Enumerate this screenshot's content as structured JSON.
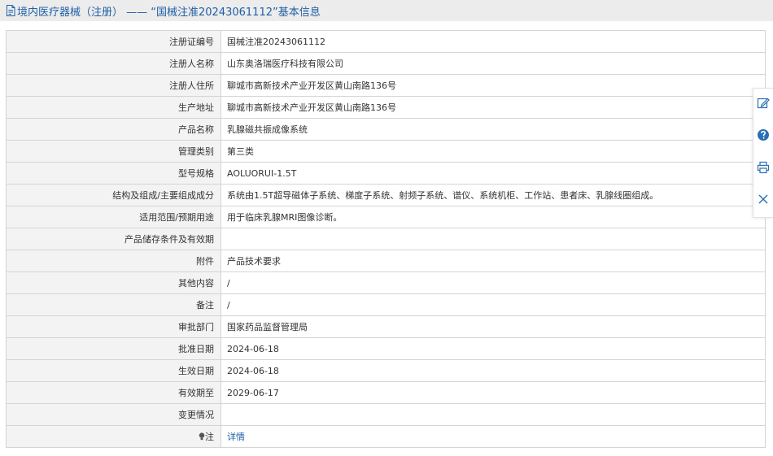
{
  "header": {
    "title": "境内医疗器械（注册） —— “国械注准20243061112”基本信息"
  },
  "colors": {
    "accent": "#1f5fa6",
    "label_bg": "#f3f3f3",
    "header_bg": "#ececec"
  },
  "rows": [
    {
      "label": "注册证编号",
      "value": "国械注准20243061112"
    },
    {
      "label": "注册人名称",
      "value": "山东奥洛瑞医疗科技有限公司"
    },
    {
      "label": "注册人住所",
      "value": "聊城市高新技术产业开发区黄山南路136号"
    },
    {
      "label": "生产地址",
      "value": "聊城市高新技术产业开发区黄山南路136号"
    },
    {
      "label": "产品名称",
      "value": "乳腺磁共振成像系统"
    },
    {
      "label": "管理类别",
      "value": "第三类"
    },
    {
      "label": "型号规格",
      "value": "AOLUORUI-1.5T"
    },
    {
      "label": "结构及组成/主要组成成分",
      "value": "系统由1.5T超导磁体子系统、梯度子系统、射频子系统、谱仪、系统机柜、工作站、患者床、乳腺线圈组成。"
    },
    {
      "label": "适用范围/预期用途",
      "value": "用于临床乳腺MRI图像诊断。"
    },
    {
      "label": "产品储存条件及有效期",
      "value": ""
    },
    {
      "label": "附件",
      "value": "产品技术要求"
    },
    {
      "label": "其他内容",
      "value": "/"
    },
    {
      "label": "备注",
      "value": "/"
    },
    {
      "label": "审批部门",
      "value": "国家药品监督管理局"
    },
    {
      "label": "批准日期",
      "value": "2024-06-18"
    },
    {
      "label": "生效日期",
      "value": "2024-06-18"
    },
    {
      "label": "有效期至",
      "value": "2029-06-17"
    },
    {
      "label": "变更情况",
      "value": ""
    }
  ],
  "note_row": {
    "label": "注",
    "link": "详情"
  },
  "side_tools": [
    "edit-icon",
    "help-icon",
    "print-icon",
    "close-icon"
  ]
}
